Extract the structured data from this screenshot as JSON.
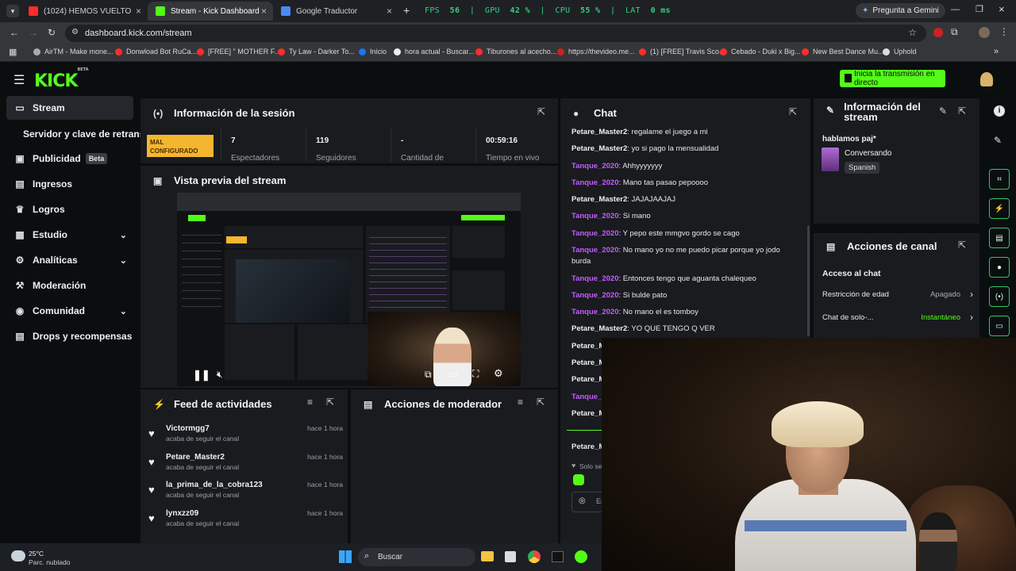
{
  "browser": {
    "tabs": [
      {
        "title": "(1024) HEMOS VUELTO A F...",
        "color": "#ff2d2d"
      },
      {
        "title": "Stream - Kick Dashboard",
        "color": "#53fc18"
      },
      {
        "title": "Google Traductor",
        "color": "#4a8af4"
      }
    ],
    "perf": {
      "fps_label": "FPS",
      "fps": "56",
      "gpu_label": "GPU",
      "gpu": "42 %",
      "cpu_label": "CPU",
      "cpu": "55 %",
      "lat_label": "LAT",
      "lat": "0 ms"
    },
    "gemini": "Pregunta a Gemini",
    "url": "dashboard.kick.com/stream",
    "bookmarks": [
      "AirTM - Make mone...",
      "Donwload Bot RuCa...",
      "[FREE] \" MOTHER F...",
      "Ty Law - Darker To...",
      "Inicio",
      "hora actual - Buscar...",
      "Tiburones al acecho...",
      "https://thevideo.me...",
      "(1) [FREE] Travis Sco...",
      "Cebado - Duki x Big...",
      "New Best Dance Mu...",
      "Uphold"
    ]
  },
  "header": {
    "logo": "KICK",
    "logo_tag": "BETA",
    "go_live": "Inicia la transmisión en directo"
  },
  "sidebar": {
    "items": [
      {
        "label": "Stream"
      },
      {
        "label": "Servidor y clave de retransm"
      },
      {
        "label": "Publicidad",
        "badge": "Beta"
      },
      {
        "label": "Ingresos"
      },
      {
        "label": "Logros"
      },
      {
        "label": "Estudio"
      },
      {
        "label": "Analíticas"
      },
      {
        "label": "Moderación"
      },
      {
        "label": "Comunidad"
      },
      {
        "label": "Drops y recompensas"
      }
    ]
  },
  "session": {
    "title": "Información de la sesión",
    "bad_config": "MAL CONFIGURADO",
    "stats": [
      {
        "value": "7",
        "label": "Espectadores"
      },
      {
        "value": "119",
        "label": "Seguidores"
      },
      {
        "value": "-",
        "label": "Cantidad de"
      },
      {
        "value": "00:59:16",
        "label": "Tiempo en vivo"
      }
    ]
  },
  "preview": {
    "title": "Vista previa del stream"
  },
  "feed": {
    "title": "Feed de actividades",
    "items": [
      {
        "user": "Victormgg7",
        "action": "acaba de seguir el canal",
        "time": "hace 1 hora"
      },
      {
        "user": "Petare_Master2",
        "action": "acaba de seguir el canal",
        "time": "hace 1 hora"
      },
      {
        "user": "la_prima_de_la_cobra123",
        "action": "acaba de seguir el canal",
        "time": "hace 1 hora"
      },
      {
        "user": "lynxzz09",
        "action": "acaba de seguir el canal",
        "time": "hace 1 hora"
      }
    ]
  },
  "moderator": {
    "title": "Acciones de moderador"
  },
  "chat": {
    "title": "Chat",
    "messages": [
      {
        "user": "Petare_Master2",
        "text": "regalame el juego a mi",
        "color": "#f0f0f0"
      },
      {
        "user": "Petare_Master2",
        "text": "yo si pago la mensualidad",
        "color": "#f0f0f0"
      },
      {
        "user": "Tanque_2020",
        "text": "Ahhyyyyyyy",
        "color": "#c35cff"
      },
      {
        "user": "Tanque_2020",
        "text": "Mano tas pasao pepoooo",
        "color": "#c35cff"
      },
      {
        "user": "Petare_Master2",
        "text": "JAJAJAAJAJ",
        "color": "#f0f0f0"
      },
      {
        "user": "Tanque_2020",
        "text": "Si mano",
        "color": "#c35cff"
      },
      {
        "user": "Tanque_2020",
        "text": "Y pepo este mmgvo gordo se cago",
        "color": "#c35cff"
      },
      {
        "user": "Tanque_2020",
        "text": "No mano yo no me puedo picar porque yo jodo burda",
        "color": "#c35cff"
      },
      {
        "user": "Tanque_2020",
        "text": "Entonces tengo que aguanta chalequeo",
        "color": "#c35cff"
      },
      {
        "user": "Tanque_2020",
        "text": "Si bulde pato",
        "color": "#c35cff"
      },
      {
        "user": "Tanque_2020",
        "text": "No mano el es tomboy",
        "color": "#c35cff"
      },
      {
        "user": "Petare_Master2",
        "text": "YO QUE TENGO Q VER",
        "color": "#f0f0f0"
      },
      {
        "user": "Petare_M",
        "text": "",
        "color": "#f0f0f0"
      },
      {
        "user": "Petare_M",
        "text": "",
        "color": "#f0f0f0"
      },
      {
        "user": "Petare_M",
        "text": "",
        "color": "#f0f0f0"
      },
      {
        "user": "Tanque_",
        "text": "",
        "color": "#c35cff"
      },
      {
        "user": "Petare_M",
        "text": "",
        "color": "#f0f0f0"
      }
    ],
    "pinned_user": "Petare_M",
    "solo": "Solo se",
    "input_placeholder": "Es"
  },
  "stream_info": {
    "title": "Información del stream",
    "stream_title": "hablamos paj*",
    "category": "Conversando",
    "language": "Spanish"
  },
  "channel_actions": {
    "title": "Acciones de canal",
    "section": "Acceso al chat",
    "rows": [
      {
        "label": "Restricción de edad",
        "value": "Apagado",
        "value_color": "#a8adb3"
      },
      {
        "label": "Chat de solo-...",
        "value": "Instantáneo",
        "value_color": "#53fc18"
      }
    ]
  },
  "taskbar": {
    "weather_temp": "25°C",
    "weather_desc": "Parc. nublado",
    "search": "Buscar"
  }
}
